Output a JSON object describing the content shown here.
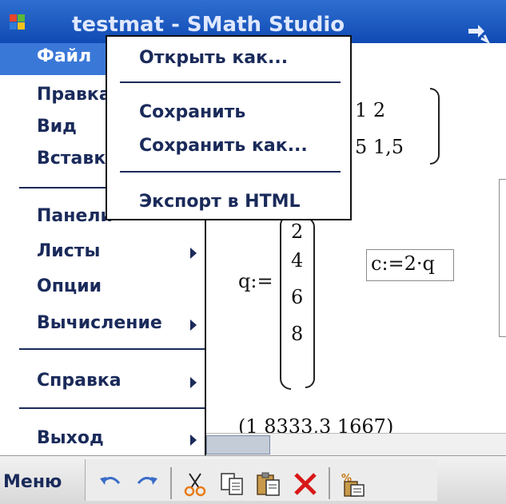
{
  "window": {
    "title": "testmat - SMath Studio"
  },
  "main_menu": {
    "items": [
      {
        "label": "Файл",
        "has_submenu": false,
        "selected": true
      },
      {
        "label": "Правка",
        "has_submenu": false
      },
      {
        "label": "Вид",
        "has_submenu": false
      },
      {
        "label": "Вставка",
        "has_submenu": false
      },
      {
        "label": "Панели",
        "has_submenu": false
      },
      {
        "label": "Листы",
        "has_submenu": true
      },
      {
        "label": "Опции",
        "has_submenu": false
      },
      {
        "label": "Вычисление",
        "has_submenu": true
      },
      {
        "label": "Справка",
        "has_submenu": true
      },
      {
        "label": "Выход",
        "has_submenu": true
      }
    ]
  },
  "file_submenu": {
    "items": [
      "Открыть как...",
      "Сохранить",
      "Сохранить как...",
      "Экспорт в HTML"
    ]
  },
  "worksheet": {
    "matrix_top": {
      "row1": "1   2",
      "row2": "5  1,5"
    },
    "q_label": "q:=",
    "q_values": [
      "2",
      "4",
      "6",
      "8"
    ],
    "c_expr": "c:=2·q",
    "bottom_result": "(1  8333,3  1667)"
  },
  "bottom_bar": {
    "menu_label": "Меню",
    "tools": [
      "undo-icon",
      "redo-icon",
      "cut-icon",
      "copy-icon",
      "paste-icon",
      "delete-icon",
      "paste-special-icon"
    ]
  },
  "colors": {
    "titlebar": "#1a58c4",
    "selection": "#3a78d8",
    "menu_text": "#1a2a5a"
  }
}
